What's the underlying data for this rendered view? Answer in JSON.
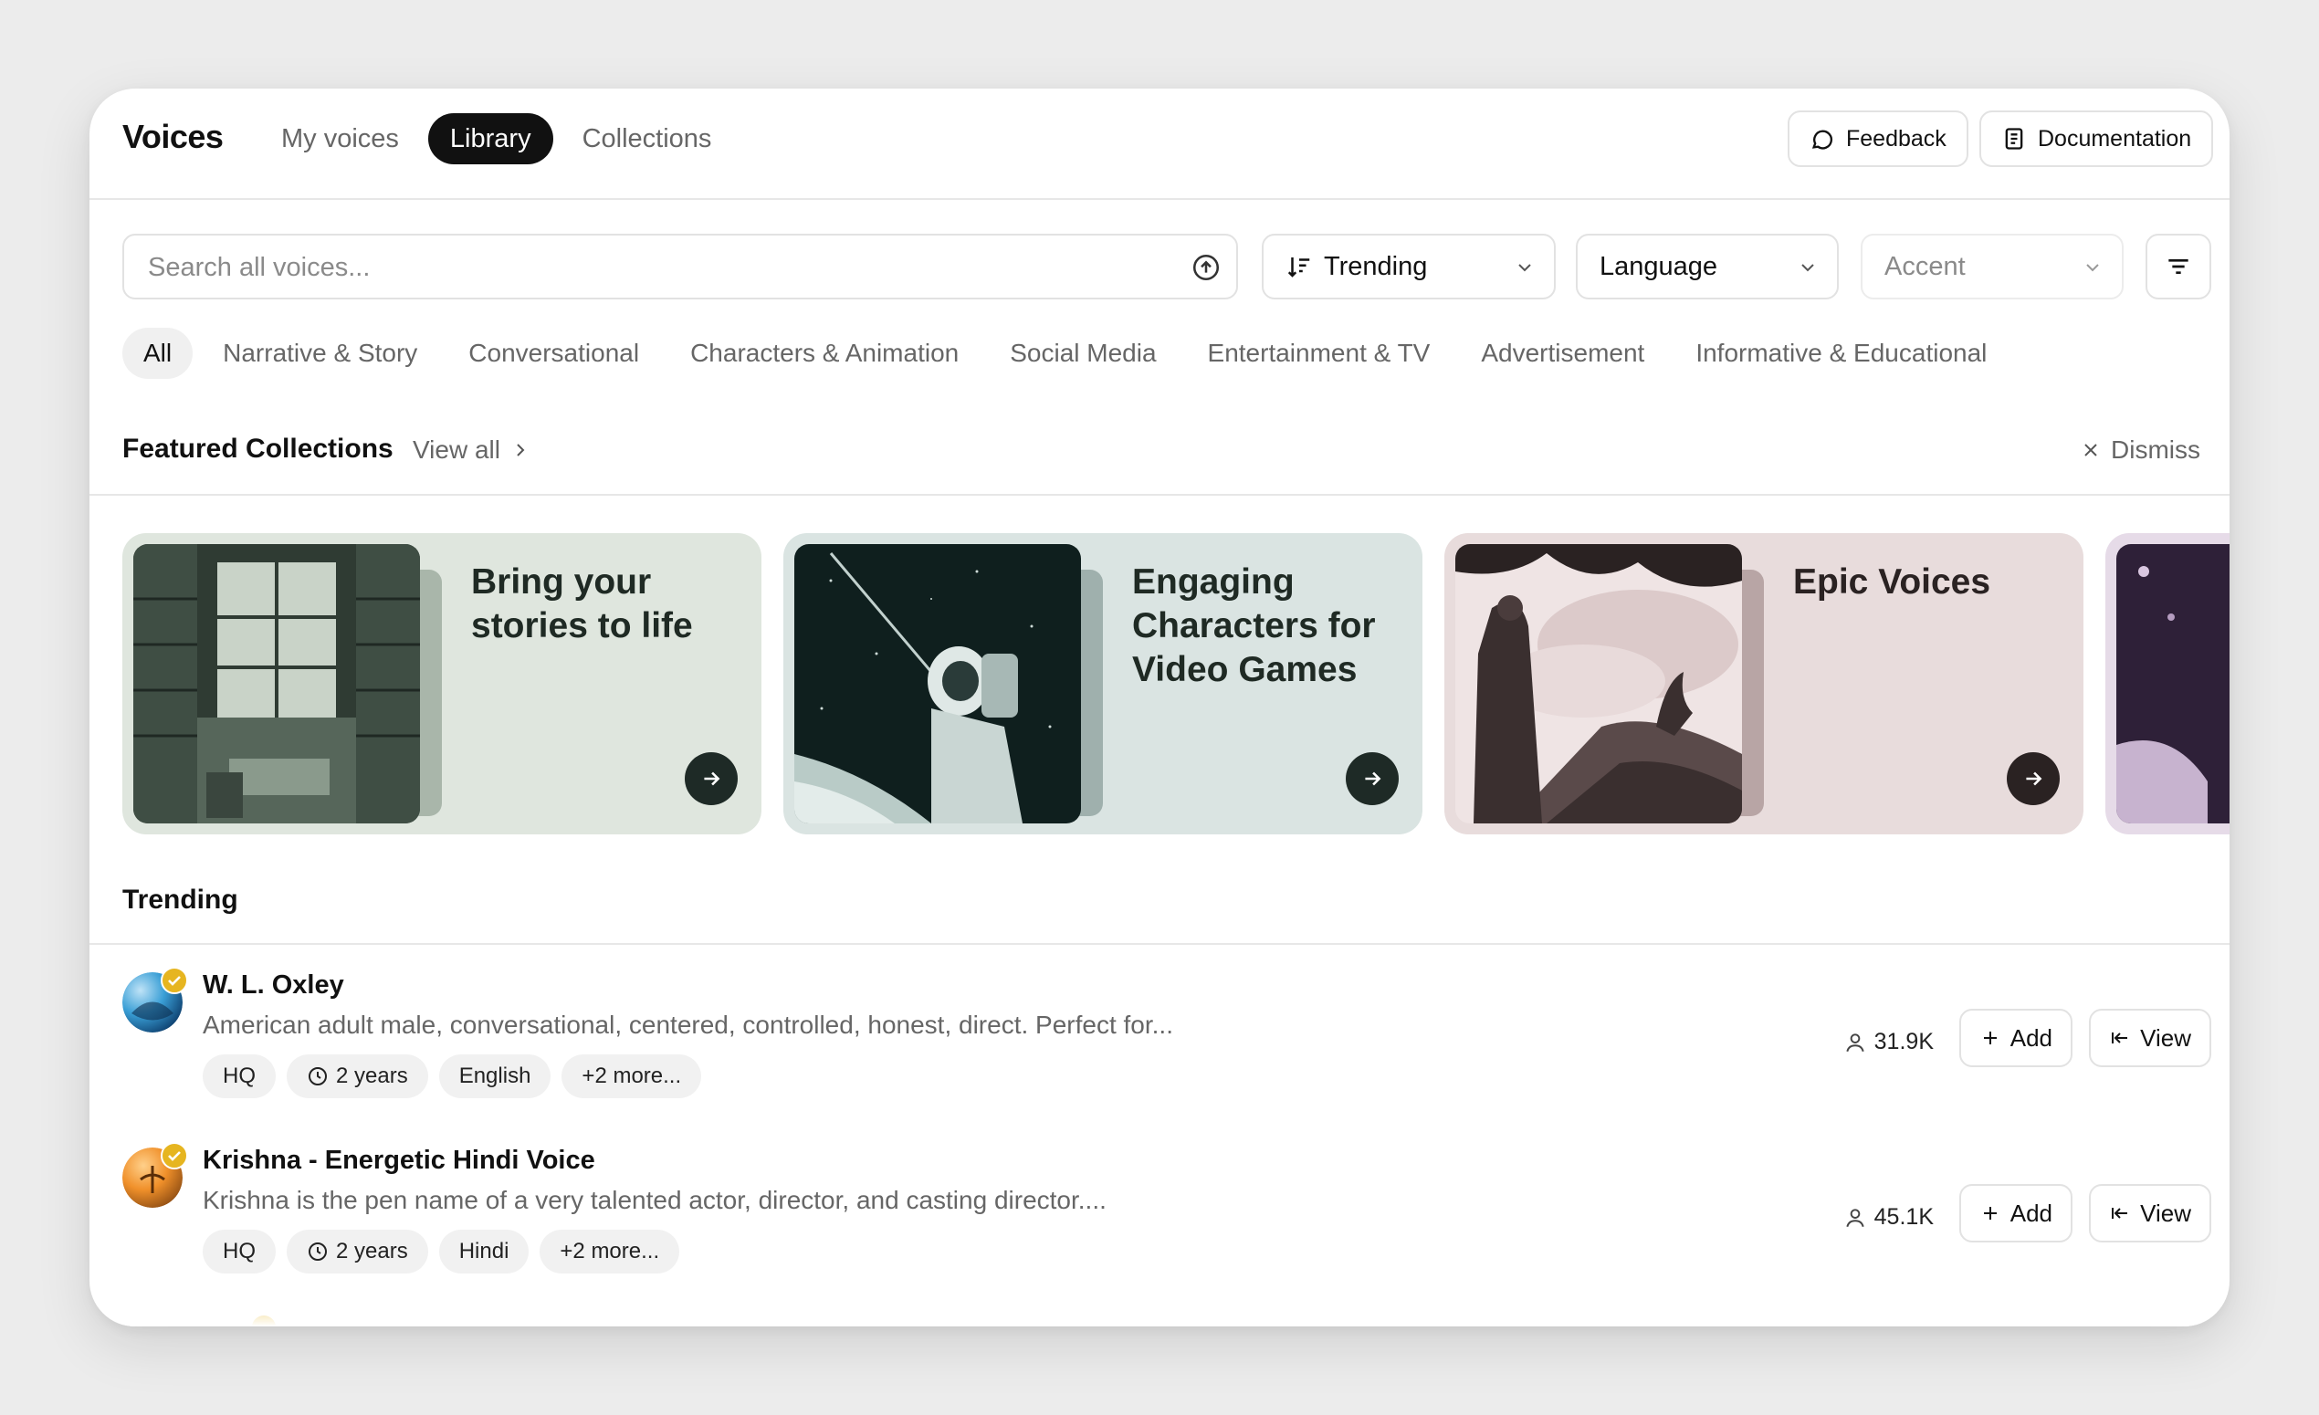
{
  "header": {
    "title": "Voices",
    "tabs": [
      {
        "label": "My voices",
        "active": false
      },
      {
        "label": "Library",
        "active": true
      },
      {
        "label": "Collections",
        "active": false
      }
    ],
    "feedback_label": "Feedback",
    "documentation_label": "Documentation"
  },
  "filters": {
    "search_placeholder": "Search all voices...",
    "sort_value": "Trending",
    "language_value": "Language",
    "accent_placeholder": "Accent"
  },
  "categories": [
    {
      "label": "All",
      "active": true
    },
    {
      "label": "Narrative & Story",
      "active": false
    },
    {
      "label": "Conversational",
      "active": false
    },
    {
      "label": "Characters & Animation",
      "active": false
    },
    {
      "label": "Social Media",
      "active": false
    },
    {
      "label": "Entertainment & TV",
      "active": false
    },
    {
      "label": "Advertisement",
      "active": false
    },
    {
      "label": "Informative & Educational",
      "active": false
    }
  ],
  "featured": {
    "title": "Featured Collections",
    "view_all": "View all",
    "dismiss": "Dismiss",
    "cards": [
      {
        "title": "Bring your stories to life",
        "bg": "#dfe6de",
        "image": "library-image"
      },
      {
        "title": "Engaging Characters for Video Games",
        "bg": "#dae4e2",
        "image": "astronaut-image"
      },
      {
        "title": "Epic Voices",
        "bg": "#e8dcdc",
        "image": "warrior-dragon-image"
      }
    ]
  },
  "trending": {
    "title": "Trending",
    "voices": [
      {
        "name": "W. L. Oxley",
        "description": "American adult male, conversational, centered, controlled, honest, direct. Perfect for...",
        "tags": [
          "HQ",
          "2 years",
          "English",
          "+2 more..."
        ],
        "count": "31.9K"
      },
      {
        "name": "Krishna - Energetic Hindi Voice",
        "description": "Krishna is the pen name of a very talented actor, director, and casting director....",
        "tags": [
          "HQ",
          "2 years",
          "Hindi",
          "+2 more..."
        ],
        "count": "45.1K"
      }
    ],
    "add_label": "Add",
    "view_label": "View"
  },
  "colors": {
    "accent": "#111111",
    "verified_badge": "#e6b520",
    "card_arrow": "#1e2a26"
  }
}
